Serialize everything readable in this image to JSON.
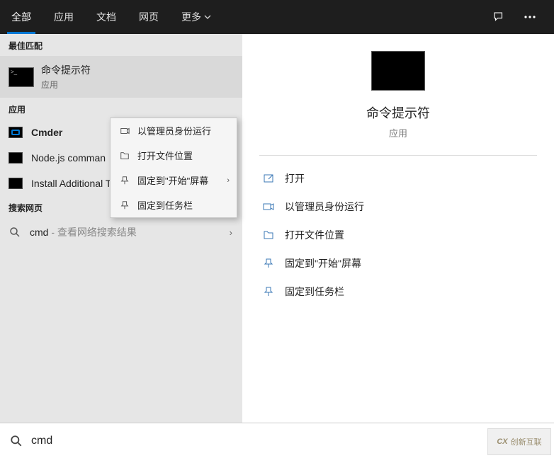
{
  "tabs": {
    "all": "全部",
    "apps": "应用",
    "docs": "文档",
    "web": "网页",
    "more": "更多"
  },
  "sections": {
    "best": "最佳匹配",
    "apps": "应用",
    "web": "搜索网页"
  },
  "best_match": {
    "title": "命令提示符",
    "subtitle": "应用"
  },
  "apps": [
    {
      "name": "Cmder"
    },
    {
      "name": "Node.js comman"
    },
    {
      "name": "Install Additional Tools for Node.js"
    }
  ],
  "web_search": {
    "query": "cmd",
    "hint": " - 查看网络搜索结果"
  },
  "context_menu": [
    {
      "label": "以管理员身份运行",
      "icon": "admin"
    },
    {
      "label": "打开文件位置",
      "icon": "folder"
    },
    {
      "label": "固定到\"开始\"屏幕",
      "icon": "pin-start",
      "has_sub": true
    },
    {
      "label": "固定到任务栏",
      "icon": "pin-taskbar"
    }
  ],
  "preview": {
    "title": "命令提示符",
    "subtitle": "应用"
  },
  "actions": [
    {
      "label": "打开",
      "icon": "open"
    },
    {
      "label": "以管理员身份运行",
      "icon": "admin"
    },
    {
      "label": "打开文件位置",
      "icon": "folder"
    },
    {
      "label": "固定到\"开始\"屏幕",
      "icon": "pin-start"
    },
    {
      "label": "固定到任务栏",
      "icon": "pin-taskbar"
    }
  ],
  "search": {
    "value": "cmd"
  },
  "watermark": "创新互联",
  "watermark_logo": "CX"
}
